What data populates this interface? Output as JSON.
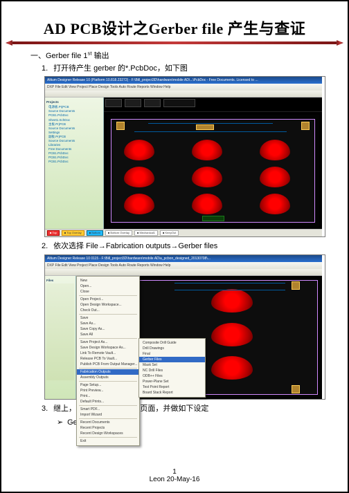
{
  "title": "AD PCB设计之Gerber file 产生与查证",
  "section": {
    "num": "一、",
    "label_a": "Gerber file 1",
    "label_sup": "st",
    "label_b": " 输出"
  },
  "steps": {
    "s1": {
      "num": "1.",
      "text": "打开待产生 gerber 的*.PcbDoc，如下图"
    },
    "s2": {
      "num": "2.",
      "text": "依次选择 File→Fabrication outputs→Gerber files"
    },
    "s3": {
      "num": "3.",
      "text": "继上，打开 Gerber setup 页面，并做如下设定"
    },
    "s3a": {
      "bullet": "➢",
      "text": "General 页面"
    }
  },
  "fig1": {
    "titlebar": "Altium Designer Release 10 (Platform 10.818.23272) - F:\\Bill_project3D\\hardware\\mobile AD\\...\\PcbDoc - Free Documents. Licensed to ...",
    "menubar": "DXP  File  Edit  View  Project  Place  Design  Tools  Auto Route  Reports  Window  Help",
    "projects": {
      "title": "Projects",
      "groups": [
        "电源板.PrjPCB",
        "主板.PrjPCB",
        "副板.PrjPCB",
        "Free Documents"
      ],
      "items": [
        "Source Documents",
        "PCB1.PcbDoc",
        "Sheet1.SchDoc",
        "Settings",
        "Libraries"
      ]
    },
    "tabs": [
      "■ Top",
      "■ Top Overlay",
      "■ Bottom",
      "■ Bottom Overlay",
      "■ Mechanical1",
      "■ KeepOut"
    ]
  },
  "fig2": {
    "titlebar": "Altium Designer Release 10 0115 - F:\\Bill_project3D\\hardware\\mobile AD\\a_pcbon_designed_20130708\\...",
    "menubar": "DXP  File  Edit  View  Project  Place  Design  Tools  Auto Route  Reports  Window  Help",
    "file_menu": [
      "New",
      "Open...",
      "Close",
      "Open Project...",
      "Open Design Workspace...",
      "Check Out...",
      "Save",
      "Save As...",
      "Save Copy As...",
      "Save All",
      "Save Project As...",
      "Save Design Workspace As...",
      "Link To Remote Vault...",
      "Release PCB To Vault...",
      "Publish PCB From Output Manager...",
      "Fabrication Outputs",
      "Assembly Outputs",
      "Page Setup...",
      "Print Preview...",
      "Print...",
      "Default Prints...",
      "Smart PDF...",
      "Import Wizard",
      "Recent Documents",
      "Recent Projects",
      "Recent Design Workspaces",
      "Exit"
    ],
    "fab_submenu": [
      "Composite Drill Guide",
      "Drill Drawings",
      "Final",
      "Gerber Files",
      "Mask Set",
      "NC Drill Files",
      "ODB++ Files",
      "Power-Plane Set",
      "Test Point Report",
      "Board Stack Report"
    ]
  },
  "footer": {
    "page": "1",
    "author_date": "Leon 20-May-16"
  }
}
